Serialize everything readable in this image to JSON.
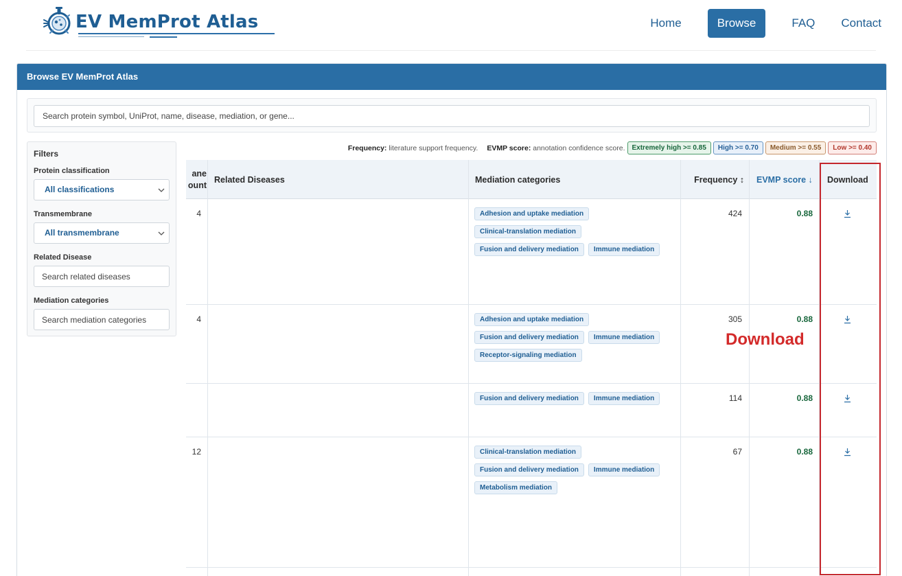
{
  "site": {
    "logo_text": "EV MemProt Atlas",
    "nav": [
      {
        "label": "Home",
        "active": false
      },
      {
        "label": "Browse",
        "active": true
      },
      {
        "label": "FAQ",
        "active": false
      },
      {
        "label": "Contact",
        "active": false
      }
    ]
  },
  "panel": {
    "title": "Browse EV MemProt Atlas",
    "search_placeholder": "Search protein symbol, UniProt, name, disease, mediation, or gene..."
  },
  "filters": {
    "title": "Filters",
    "protein_classification": {
      "label": "Protein classification",
      "value": "All classifications"
    },
    "transmembrane": {
      "label": "Transmembrane",
      "value": "All transmembrane"
    },
    "related_disease": {
      "label": "Related Disease",
      "placeholder": "Search related diseases"
    },
    "mediation_categories": {
      "label": "Mediation categories",
      "placeholder": "Search mediation categories"
    }
  },
  "legend": {
    "frequency_label": "Frequency:",
    "frequency_desc": "literature support frequency.",
    "score_label": "EVMP score:",
    "score_desc": "annotation confidence score.",
    "badges": [
      "Extremely high >= 0.85",
      "High >= 0.70",
      "Medium >= 0.55",
      "Low >= 0.40"
    ]
  },
  "table": {
    "columns": {
      "tm_count_line1": "ane",
      "tm_count_line2": "ount",
      "related_diseases": "Related Diseases",
      "mediation": "Mediation categories",
      "frequency": "Frequency ↕",
      "score": "EVMP score ↓",
      "download": "Download"
    },
    "rows": [
      {
        "tm": "4",
        "diseases": "",
        "mediation": [
          "Adhesion and uptake mediation",
          "Clinical-translation mediation",
          "Fusion and delivery mediation",
          "Immune mediation"
        ],
        "frequency": "424",
        "score": "0.88"
      },
      {
        "tm": "4",
        "diseases": "",
        "mediation": [
          "Adhesion and uptake mediation",
          "Fusion and delivery mediation",
          "Immune mediation",
          "Receptor-signaling mediation"
        ],
        "frequency": "305",
        "score": "0.88"
      },
      {
        "tm": "",
        "diseases": "",
        "mediation": [
          "Fusion and delivery mediation",
          "Immune mediation"
        ],
        "frequency": "114",
        "score": "0.88"
      },
      {
        "tm": "12",
        "diseases": "",
        "mediation": [
          "Clinical-translation mediation",
          "Fusion and delivery mediation",
          "Immune mediation",
          "Metabolism mediation"
        ],
        "frequency": "67",
        "score": "0.88"
      }
    ]
  },
  "annotation": {
    "label": "Download",
    "color": "#d32a2a"
  },
  "colors": {
    "brand": "#2a6ea5",
    "score_green": "#17663b"
  }
}
